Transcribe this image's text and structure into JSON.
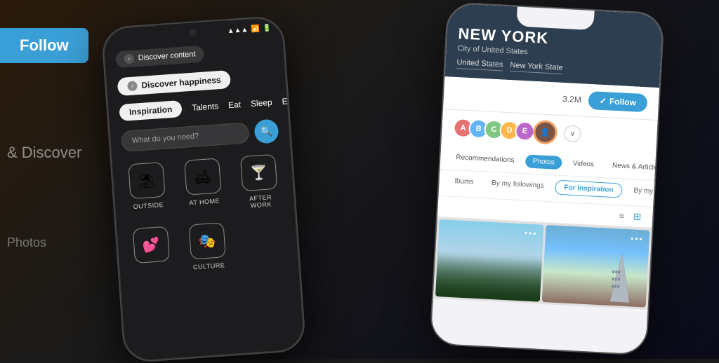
{
  "background": {
    "follow_btn": "Follow",
    "discover_text": "& Discover",
    "photos_text": "Photos"
  },
  "phone_left": {
    "discover_content_label": "Discover content",
    "discover_happiness_label": "Discover happiness",
    "tags": [
      "Inspiration",
      "Talents",
      "Eat",
      "Sleep",
      "Events"
    ],
    "search_placeholder": "What do you need?",
    "icons": [
      {
        "emoji": "⛱",
        "label": "OUTSIDE"
      },
      {
        "emoji": "🛋",
        "label": "AT HOME"
      },
      {
        "emoji": "🍸",
        "label": "AFTER WORK"
      },
      {
        "emoji": "❤",
        "label": ""
      },
      {
        "emoji": "🎭",
        "label": "CULTURE"
      }
    ]
  },
  "phone_right": {
    "city": "NEW YORK",
    "subtitle": "City of United States",
    "tags": [
      "United States",
      "New York State"
    ],
    "followers": "3.2M",
    "follow_label": "Follow",
    "filter_tabs_row1": [
      "Recommendations",
      "Photos",
      "Videos",
      "News & Articles"
    ],
    "filter_tabs_row2": [
      "By my followings",
      "For Inspiration",
      "By my friends"
    ],
    "view_controls": [
      "≡",
      "⊞"
    ]
  }
}
